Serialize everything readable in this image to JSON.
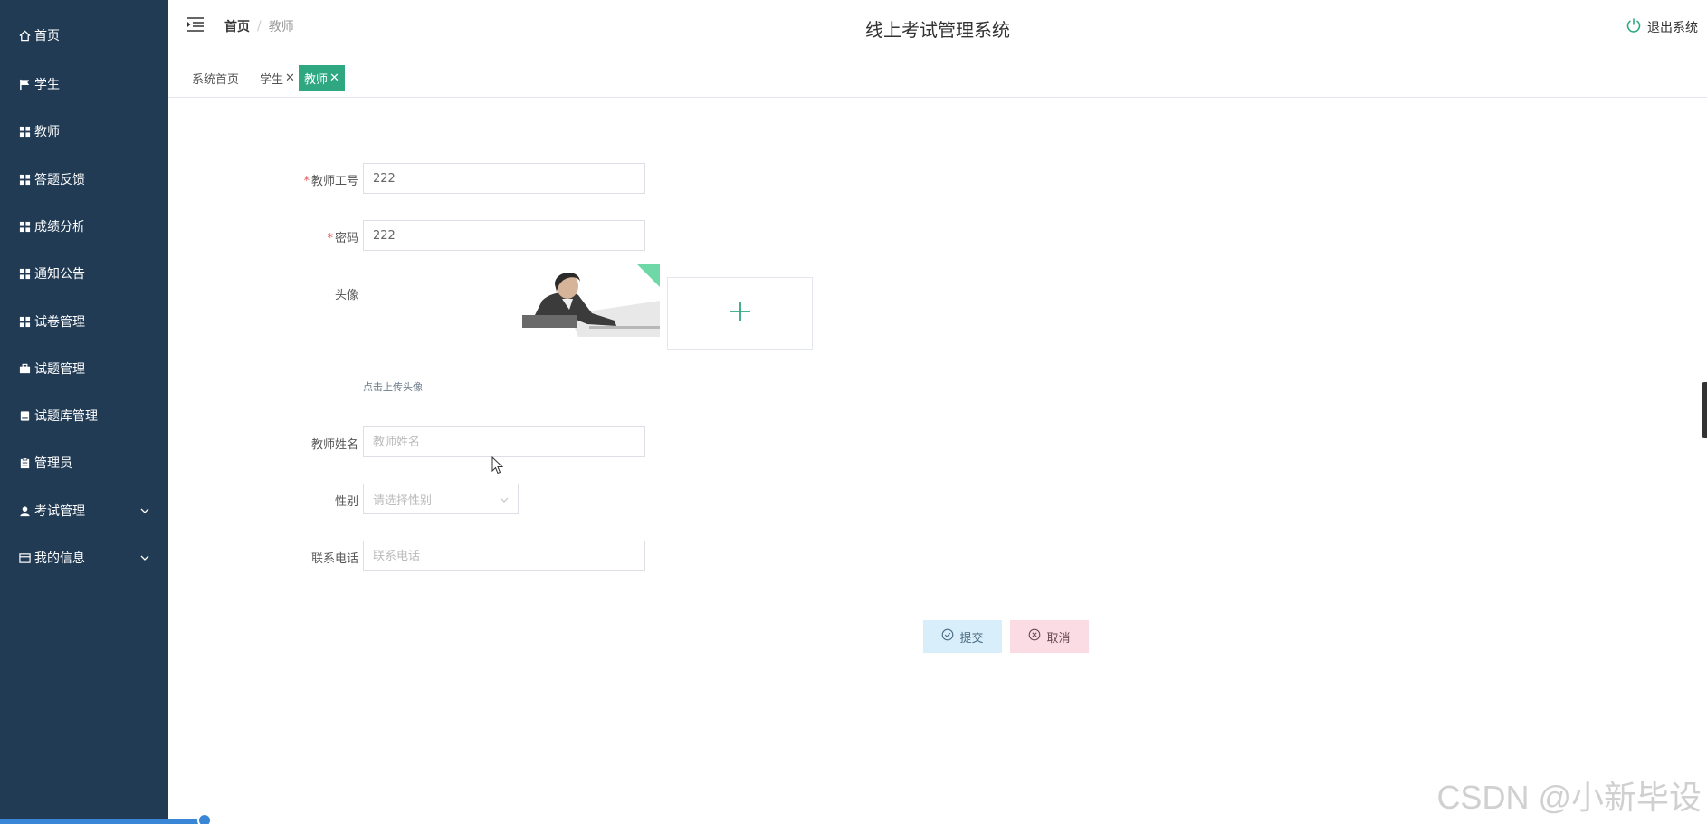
{
  "sidebar": {
    "items": [
      {
        "label": "首页",
        "icon": "home-icon"
      },
      {
        "label": "学生",
        "icon": "flag-icon"
      },
      {
        "label": "教师",
        "icon": "grid-icon"
      },
      {
        "label": "答题反馈",
        "icon": "grid-icon"
      },
      {
        "label": "成绩分析",
        "icon": "grid-icon"
      },
      {
        "label": "通知公告",
        "icon": "grid-icon"
      },
      {
        "label": "试卷管理",
        "icon": "grid-icon"
      },
      {
        "label": "试题管理",
        "icon": "briefcase-icon"
      },
      {
        "label": "试题库管理",
        "icon": "book-icon"
      },
      {
        "label": "管理员",
        "icon": "clipboard-icon"
      },
      {
        "label": "考试管理",
        "icon": "user-icon"
      },
      {
        "label": "我的信息",
        "icon": "card-icon"
      }
    ]
  },
  "header": {
    "breadcrumb": {
      "home": "首页",
      "current": "教师",
      "separator": "/"
    },
    "title": "线上考试管理系统",
    "logout_label": "退出系统"
  },
  "tabs": [
    {
      "label": "系统首页",
      "closable": false,
      "active": false
    },
    {
      "label": "学生",
      "closable": true,
      "active": false
    },
    {
      "label": "教师",
      "closable": true,
      "active": true
    }
  ],
  "tab_close_glyph": "✕",
  "form": {
    "teacher_id": {
      "label": "教师工号",
      "value": "222",
      "required": true
    },
    "password": {
      "label": "密码",
      "value": "222",
      "required": true
    },
    "avatar": {
      "label": "头像",
      "upload_hint": "点击上传头像"
    },
    "teacher_name": {
      "label": "教师姓名",
      "placeholder": "教师姓名",
      "value": ""
    },
    "gender": {
      "label": "性别",
      "placeholder": "请选择性别"
    },
    "phone": {
      "label": "联系电话",
      "placeholder": "联系电话",
      "value": ""
    }
  },
  "buttons": {
    "submit": "提交",
    "cancel": "取消"
  },
  "watermark": "CSDN @小新毕设",
  "colors": {
    "sidebar_bg": "#213b55",
    "accent": "#2fa882",
    "submit_bg": "#d9eefb",
    "cancel_bg": "#fbdce4"
  }
}
